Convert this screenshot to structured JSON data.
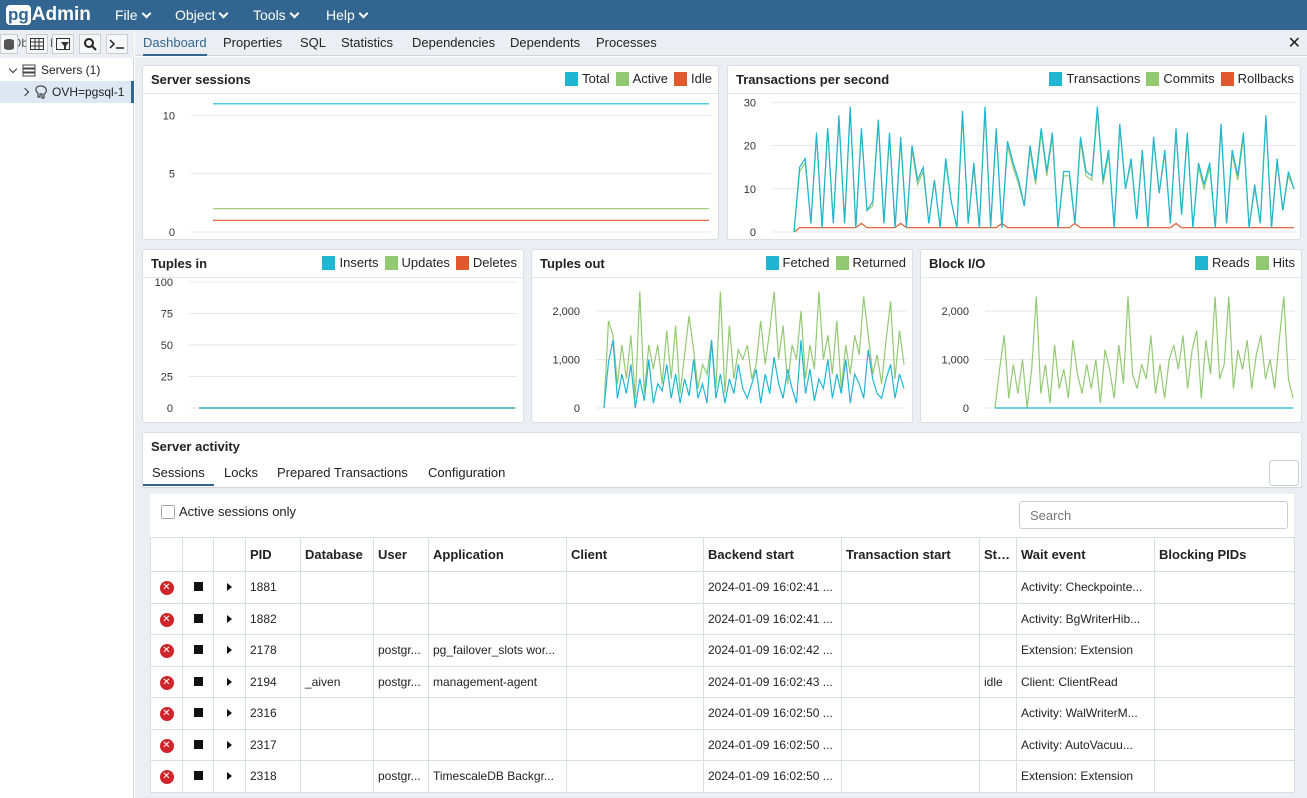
{
  "app": {
    "logo_pg": "pg",
    "logo_text": "Admin"
  },
  "menu": [
    "File",
    "Object",
    "Tools",
    "Help"
  ],
  "browser": {
    "toolbar_label": "Object Explorer",
    "servers_label": "Servers (1)",
    "server_name": "OVH=pgsql-1"
  },
  "tabs": [
    "Dashboard",
    "Properties",
    "SQL",
    "Statistics",
    "Dependencies",
    "Dependents",
    "Processes"
  ],
  "close_glyph": "✕",
  "colors": {
    "blue": "#1fb6d2",
    "green": "#94c973",
    "red": "#e0582d",
    "brand": "#326690"
  },
  "cards": {
    "sessions": {
      "title": "Server sessions",
      "legend": [
        "Total",
        "Active",
        "Idle"
      ]
    },
    "tps": {
      "title": "Transactions per second",
      "legend": [
        "Transactions",
        "Commits",
        "Rollbacks"
      ]
    },
    "tuples_in": {
      "title": "Tuples in",
      "legend": [
        "Inserts",
        "Updates",
        "Deletes"
      ]
    },
    "tuples_out": {
      "title": "Tuples out",
      "legend": [
        "Fetched",
        "Returned"
      ]
    },
    "block_io": {
      "title": "Block I/O",
      "legend": [
        "Reads",
        "Hits"
      ]
    }
  },
  "activity": {
    "title": "Server activity",
    "tabs": [
      "Sessions",
      "Locks",
      "Prepared Transactions",
      "Configuration"
    ],
    "active_only_label": "Active sessions only",
    "search_placeholder": "Search",
    "columns": [
      "",
      "",
      "",
      "PID",
      "Database",
      "User",
      "Application",
      "Client",
      "Backend start",
      "Transaction start",
      "State",
      "Wait event",
      "Blocking PIDs"
    ],
    "rows": [
      {
        "pid": "1881",
        "database": "",
        "user": "",
        "application": "",
        "client": "",
        "backend_start": "2024-01-09 16:02:41 ...",
        "transaction_start": "",
        "state": "",
        "wait_event": "Activity: Checkpointe...",
        "blocking": ""
      },
      {
        "pid": "1882",
        "database": "",
        "user": "",
        "application": "",
        "client": "",
        "backend_start": "2024-01-09 16:02:41 ...",
        "transaction_start": "",
        "state": "",
        "wait_event": "Activity: BgWriterHib...",
        "blocking": ""
      },
      {
        "pid": "2178",
        "database": "",
        "user": "postgr...",
        "application": "pg_failover_slots wor...",
        "client": "",
        "backend_start": "2024-01-09 16:02:42 ...",
        "transaction_start": "",
        "state": "",
        "wait_event": "Extension: Extension",
        "blocking": ""
      },
      {
        "pid": "2194",
        "database": "_aiven",
        "user": "postgr...",
        "application": "management-agent",
        "client": "",
        "backend_start": "2024-01-09 16:02:43 ...",
        "transaction_start": "",
        "state": "idle",
        "wait_event": "Client: ClientRead",
        "blocking": ""
      },
      {
        "pid": "2316",
        "database": "",
        "user": "",
        "application": "",
        "client": "",
        "backend_start": "2024-01-09 16:02:50 ...",
        "transaction_start": "",
        "state": "",
        "wait_event": "Activity: WalWriterM...",
        "blocking": ""
      },
      {
        "pid": "2317",
        "database": "",
        "user": "",
        "application": "",
        "client": "",
        "backend_start": "2024-01-09 16:02:50 ...",
        "transaction_start": "",
        "state": "",
        "wait_event": "Activity: AutoVacuu...",
        "blocking": ""
      },
      {
        "pid": "2318",
        "database": "",
        "user": "postgr...",
        "application": "TimescaleDB Backgr...",
        "client": "",
        "backend_start": "2024-01-09 16:02:50 ...",
        "transaction_start": "",
        "state": "",
        "wait_event": "Extension: Extension",
        "blocking": ""
      }
    ]
  },
  "chart_data": [
    {
      "type": "line",
      "title": "Server sessions",
      "ylim": [
        0,
        11.5
      ],
      "yticks": [
        "0",
        "5",
        "10"
      ],
      "series": [
        {
          "name": "Total",
          "values": [
            11,
            11
          ]
        },
        {
          "name": "Active",
          "values": [
            2,
            2
          ]
        },
        {
          "name": "Idle",
          "values": [
            1,
            1
          ]
        }
      ]
    },
    {
      "type": "line",
      "title": "Transactions per second",
      "ylim": [
        0,
        31
      ],
      "yticks": [
        "0",
        "10",
        "20",
        "30"
      ],
      "series": [
        {
          "name": "Transactions",
          "values": [
            0,
            15,
            17,
            2,
            23,
            1,
            24,
            2,
            27,
            2,
            29,
            1,
            24,
            5,
            7,
            26,
            2,
            23,
            1,
            22,
            1,
            20,
            12,
            15,
            2,
            12,
            1,
            17,
            7,
            1,
            28,
            2,
            16,
            1,
            29,
            1,
            24,
            1,
            21,
            16,
            12,
            6,
            20,
            12,
            24,
            14,
            23,
            1,
            14,
            14,
            2,
            22,
            14,
            13,
            29,
            12,
            19,
            1,
            25,
            10,
            17,
            3,
            19,
            1,
            22,
            9,
            19,
            2,
            24,
            4,
            23,
            1,
            16,
            11,
            16,
            1,
            25,
            2,
            19,
            13,
            23,
            1,
            11,
            2,
            27,
            1,
            17,
            5,
            14,
            10
          ]
        },
        {
          "name": "Commits",
          "values": [
            0,
            14,
            16,
            2,
            22,
            1,
            24,
            2,
            26,
            2,
            28,
            1,
            23,
            5,
            6,
            25,
            2,
            22,
            1,
            21,
            1,
            19,
            11,
            14,
            2,
            12,
            1,
            16,
            7,
            1,
            27,
            2,
            15,
            1,
            28,
            1,
            23,
            1,
            20,
            15,
            11,
            6,
            19,
            11,
            23,
            13,
            22,
            1,
            13,
            13,
            2,
            21,
            13,
            12,
            28,
            11,
            18,
            1,
            24,
            10,
            16,
            3,
            18,
            1,
            21,
            9,
            18,
            2,
            23,
            4,
            22,
            1,
            15,
            10,
            15,
            1,
            24,
            2,
            18,
            12,
            22,
            1,
            10,
            2,
            26,
            1,
            16,
            5,
            13,
            10
          ]
        },
        {
          "name": "Rollbacks",
          "values": [
            0,
            1,
            1,
            1,
            1,
            1,
            1,
            1,
            1,
            1,
            1,
            1,
            2,
            1,
            1,
            1,
            1,
            1,
            1,
            2,
            1,
            1,
            1,
            1,
            1,
            1,
            1,
            1,
            1,
            1,
            1,
            1,
            1,
            1,
            1,
            1,
            1,
            2,
            1,
            1,
            1,
            1,
            1,
            1,
            1,
            1,
            1,
            1,
            1,
            1,
            2,
            1,
            1,
            1,
            1,
            1,
            1,
            1,
            1,
            1,
            1,
            1,
            1,
            1,
            1,
            1,
            1,
            1,
            2,
            1,
            1,
            1,
            1,
            1,
            1,
            1,
            1,
            1,
            1,
            1,
            1,
            1,
            1,
            1,
            1,
            1,
            1,
            1,
            1,
            1
          ]
        }
      ]
    },
    {
      "type": "line",
      "title": "Tuples in",
      "ylim": [
        0,
        100
      ],
      "yticks": [
        "0",
        "25",
        "50",
        "75",
        "100"
      ],
      "series": [
        {
          "name": "Inserts",
          "values": [
            0,
            0
          ]
        },
        {
          "name": "Updates",
          "values": [
            0,
            0
          ]
        },
        {
          "name": "Deletes",
          "values": [
            0,
            0
          ]
        }
      ]
    },
    {
      "type": "line",
      "title": "Tuples out",
      "ylim": [
        0,
        2600
      ],
      "yticks": [
        "0",
        "1,000",
        "2,000"
      ],
      "series": [
        {
          "name": "Fetched",
          "values": [
            0,
            950,
            1400,
            200,
            700,
            300,
            900,
            0,
            600,
            150,
            1000,
            100,
            500,
            350,
            900,
            200,
            700,
            100,
            600,
            250,
            1000,
            200,
            500,
            100,
            1400,
            200,
            700,
            100,
            600,
            300,
            900,
            400,
            200,
            500,
            800,
            100,
            700,
            300,
            1050,
            500,
            200,
            800,
            400,
            100,
            1400,
            300,
            800,
            150,
            600,
            400,
            1000,
            200,
            700,
            300,
            1000,
            100,
            700,
            500,
            200,
            1200,
            600,
            300,
            200,
            600,
            900,
            200,
            700,
            400
          ]
        },
        {
          "name": "Returned",
          "values": [
            0,
            1800,
            1500,
            500,
            1300,
            600,
            1500,
            200,
            2400,
            300,
            1300,
            800,
            1300,
            500,
            1600,
            600,
            1700,
            300,
            1100,
            1900,
            1200,
            400,
            900,
            700,
            1400,
            400,
            2400,
            300,
            1700,
            600,
            1200,
            1000,
            1300,
            600,
            900,
            1800,
            900,
            1600,
            2400,
            1000,
            1700,
            500,
            1300,
            1000,
            2000,
            600,
            1300,
            800,
            2400,
            1000,
            1500,
            700,
            1800,
            400,
            1300,
            700,
            1500,
            1100,
            2300,
            1500,
            700,
            1100,
            500,
            1400,
            2200,
            600,
            1600,
            900
          ]
        }
      ]
    },
    {
      "type": "line",
      "title": "Block I/O",
      "ylim": [
        0,
        2600
      ],
      "yticks": [
        "0",
        "1,000",
        "2,000"
      ],
      "series": [
        {
          "name": "Reads",
          "values": [
            0,
            0
          ]
        },
        {
          "name": "Hits",
          "values": [
            0,
            800,
            1500,
            200,
            900,
            300,
            1000,
            0,
            800,
            2300,
            300,
            900,
            100,
            1300,
            400,
            800,
            200,
            1400,
            700,
            300,
            900,
            400,
            1000,
            100,
            1200,
            800,
            200,
            1300,
            500,
            2300,
            700,
            400,
            900,
            600,
            1500,
            300,
            900,
            200,
            1000,
            1300,
            800,
            1500,
            400,
            1200,
            1600,
            200,
            1400,
            700,
            2300,
            600,
            900,
            2300,
            400,
            1200,
            800,
            1400,
            400,
            1100,
            1500,
            600,
            1000,
            400,
            1400,
            2300,
            600,
            200
          ]
        }
      ]
    }
  ]
}
